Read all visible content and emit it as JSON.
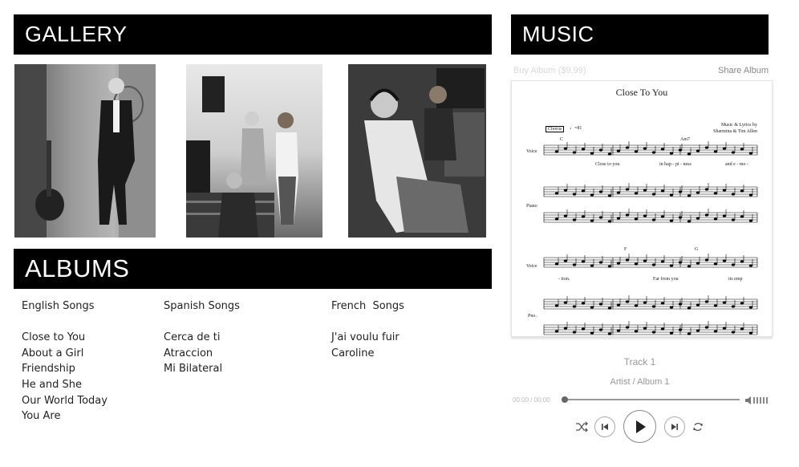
{
  "gallery": {
    "title": "GALLERY"
  },
  "music": {
    "title": "MUSIC",
    "buy_label": "Buy Album ($9.99)",
    "share_label": "Share Album",
    "sheet": {
      "song_title": "Close To You",
      "credits_line1": "Music & Lyrics by",
      "credits_line2": "Sharmina & Tim Allen",
      "section_tag": "Chorus",
      "tempo": "♩=81",
      "chords_row1": [
        "C",
        "Am7"
      ],
      "chords_row2": [
        "F",
        "G"
      ],
      "lyrics_row1": [
        "Close   to   you",
        "in   hap - pi - ness",
        "and  e - mo -"
      ],
      "lyrics_row2": [
        "- tion.",
        "Far   from   you",
        "its   emp"
      ],
      "staff_labels": [
        "Voice",
        "Piano",
        "Voice",
        "Pno."
      ]
    },
    "player": {
      "track_title": "Track 1",
      "track_artist": "Artist / Album 1",
      "time": "00:00 / 00:00",
      "progress": 0
    },
    "icons": [
      "shuffle-icon",
      "previous-icon",
      "play-icon",
      "next-icon",
      "repeat-icon",
      "volume-icon"
    ]
  },
  "albums": {
    "title": "ALBUMS",
    "columns": [
      {
        "heading": "English Songs",
        "songs": [
          "Close to You",
          "About a Girl",
          "Friendship",
          "He and She",
          "Our World Today",
          "You Are"
        ]
      },
      {
        "heading": "Spanish Songs",
        "songs": [
          "Cerca de ti",
          "Atraccion",
          "Mi Bilateral"
        ]
      },
      {
        "heading": "French  Songs",
        "songs": [
          "J'ai voulu fuir",
          "Caroline"
        ]
      }
    ]
  },
  "colors": {
    "bar_bg": "#000000",
    "bar_text": "#ffffff",
    "muted_text": "#999999"
  }
}
